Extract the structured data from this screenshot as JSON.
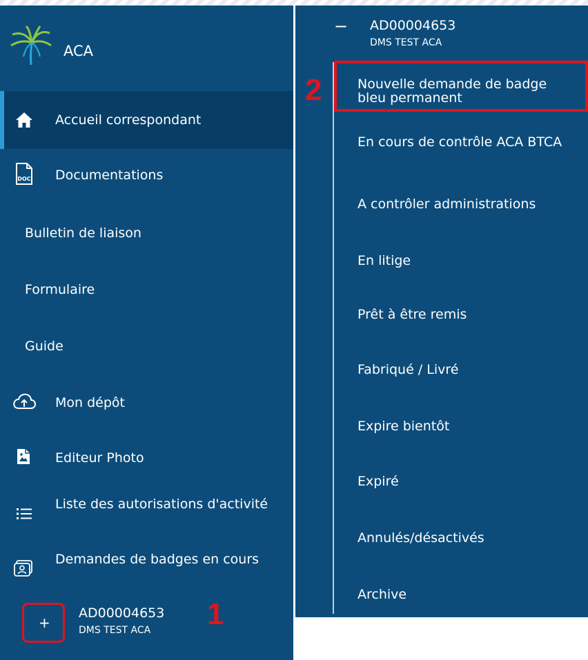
{
  "brand": {
    "name": "ACA"
  },
  "sidebar": {
    "items": [
      {
        "label": "Accueil correspondant",
        "icon": "home-icon",
        "active": true
      },
      {
        "label": "Documentations",
        "icon": "doc-file-icon"
      },
      {
        "label": "Bulletin de liaison"
      },
      {
        "label": "Formulaire"
      },
      {
        "label": "Guide"
      },
      {
        "label": "Mon dépôt",
        "icon": "cloud-upload-icon"
      },
      {
        "label": "Editeur Photo",
        "icon": "photo-file-icon"
      },
      {
        "label": "Liste des autorisations d'activité",
        "icon": "list-icon"
      },
      {
        "label": "Demandes de badges en cours",
        "icon": "badge-icon"
      }
    ],
    "account": {
      "expand_symbol": "+",
      "id": "AD00004653",
      "name": "DMS TEST ACA"
    },
    "marker": "1"
  },
  "submenu": {
    "collapse_symbol": "−",
    "account": {
      "id": "AD00004653",
      "name": "DMS TEST ACA"
    },
    "items": [
      "Nouvelle demande de badge bleu permanent",
      "En cours de contrôle ACA BTCA",
      "A contrôler administrations",
      "En litige",
      "Prêt à être remis",
      "Fabriqué / Livré",
      "Expire bientôt",
      "Expiré",
      "Annulés/désactivés",
      "Archive"
    ],
    "marker": "2"
  },
  "colors": {
    "panel": "#0d4c7a",
    "active": "#083e66",
    "active_bar": "#2e9bd6",
    "highlight": "#e0141e",
    "logo_green": "#8dc63f",
    "logo_blue": "#29a8e0"
  }
}
